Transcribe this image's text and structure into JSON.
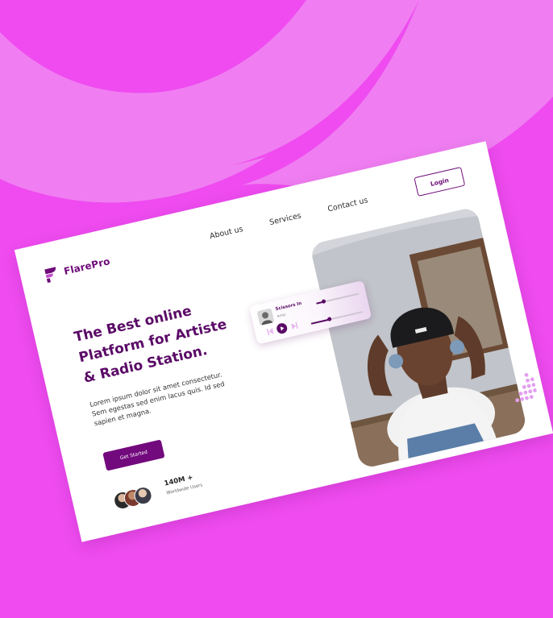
{
  "brand": {
    "name": "FlarePro",
    "accent": "#6d0a78",
    "background": "#ef4bf0"
  },
  "nav": {
    "items": [
      "About us",
      "Services",
      "Contact us"
    ],
    "login_label": "Login"
  },
  "hero": {
    "headline_lines": [
      "The Best online",
      "Platform for Artiste",
      "& Radio Station."
    ],
    "lead_lines": [
      "Lorem ipsum dolor sit amet consectetur.",
      "Sem egestas sed enim lacus quis. Id sed",
      "sapien et magna."
    ],
    "cta_label": "Get Started"
  },
  "stats": {
    "value": "140M +",
    "label": "Worldwide Users"
  },
  "player": {
    "song_title": "Scissors In",
    "artist": "Artist",
    "volume_level": 0.18,
    "progress_level": 0.35
  },
  "icons": [
    "flarepro-logo-icon",
    "previous-icon",
    "play-icon",
    "next-icon",
    "headphones-icon"
  ]
}
